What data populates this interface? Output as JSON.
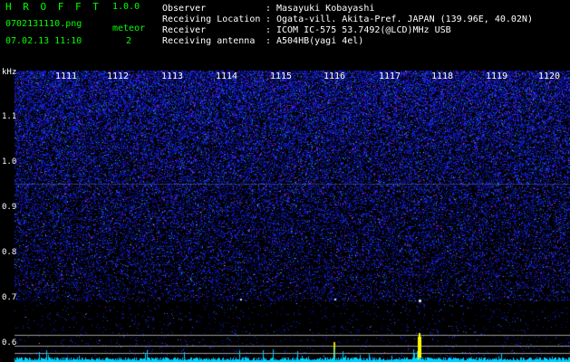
{
  "app": {
    "title": "H R O F F T",
    "version": "1.0.0"
  },
  "file": {
    "name": "0702131110.png",
    "datetime": "07.02.13 11:10"
  },
  "meteor": {
    "label": "meteor",
    "count": "2"
  },
  "info": [
    {
      "label": "Observer",
      "sep": ":",
      "value": "Masayuki Kobayashi"
    },
    {
      "label": "Receiving Location",
      "sep": ":",
      "value": "Ogata-vill. Akita-Pref. JAPAN (139.96E, 40.02N)"
    },
    {
      "label": "Receiver",
      "sep": ":",
      "value": "ICOM IC-575 53.7492(@LCD)MHz USB"
    },
    {
      "label": "Receiving antenna",
      "sep": ":",
      "value": "A504HB(yagi 4el)"
    }
  ],
  "spectrogram": {
    "y_unit": "kHz",
    "y_ticks": [
      "1.1",
      "1.0",
      "0.9",
      "0.8",
      "0.7",
      "0.6"
    ],
    "y_range": [
      0.55,
      1.15
    ],
    "x_ticks": [
      "1111",
      "1112",
      "1113",
      "1114",
      "1115",
      "1116",
      "1117",
      "1118",
      "1119",
      "1120"
    ],
    "colors": {
      "background": "#000000",
      "noise": "#2030c0",
      "signal": "#ffff00",
      "trace": "#00e0ff",
      "label": "#00ff00"
    }
  }
}
